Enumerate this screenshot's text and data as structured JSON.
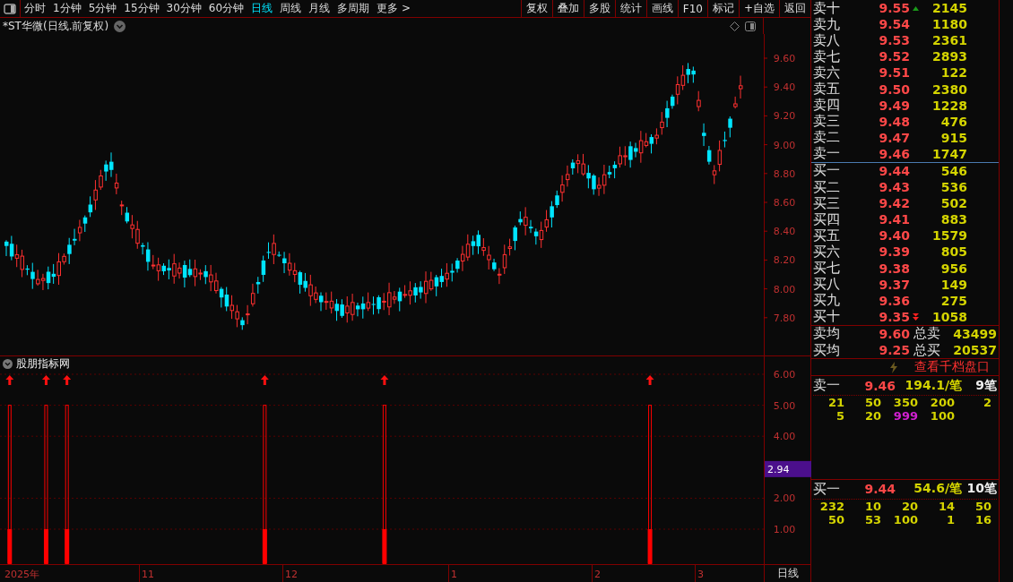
{
  "toolbar": {
    "periods": [
      {
        "label": "分时",
        "selected": false
      },
      {
        "label": "1分钟",
        "selected": false
      },
      {
        "label": "5分钟",
        "selected": false
      },
      {
        "label": "15分钟",
        "selected": false
      },
      {
        "label": "30分钟",
        "selected": false
      },
      {
        "label": "60分钟",
        "selected": false
      },
      {
        "label": "日线",
        "selected": true
      },
      {
        "label": "周线",
        "selected": false
      },
      {
        "label": "月线",
        "selected": false
      },
      {
        "label": "多周期",
        "selected": false
      },
      {
        "label": "更多 >",
        "selected": false
      }
    ],
    "actions": [
      "复权",
      "叠加",
      "多股",
      "统计",
      "画线",
      "F10",
      "标记",
      "+自选",
      "返回"
    ]
  },
  "main_chart": {
    "title": "*ST华微(日线.前复权)",
    "price_ticks": [
      "9.60",
      "9.40",
      "9.20",
      "9.00",
      "8.80",
      "8.60",
      "8.40",
      "8.20",
      "8.00",
      "7.80"
    ]
  },
  "indicator": {
    "title": "股朋指标网",
    "current_value": "2.94",
    "ticks": [
      "6.00",
      "5.00",
      "4.00",
      "2.00",
      "1.00"
    ]
  },
  "date_axis": {
    "labels": [
      "2025年",
      "11",
      "12",
      "1",
      "2",
      "3"
    ],
    "period": "日线"
  },
  "order_book": {
    "asks": [
      {
        "label": "卖十",
        "price": "9.55",
        "volume": "2145",
        "kind": "top"
      },
      {
        "label": "卖九",
        "price": "9.54",
        "volume": "1180",
        "kind": "plain"
      },
      {
        "label": "卖八",
        "price": "9.53",
        "volume": "2361",
        "kind": "plain"
      },
      {
        "label": "卖七",
        "price": "9.52",
        "volume": "2893",
        "kind": "plain"
      },
      {
        "label": "卖六",
        "price": "9.51",
        "volume": "122",
        "kind": "plain"
      },
      {
        "label": "卖五",
        "price": "9.50",
        "volume": "2380",
        "kind": "plain"
      },
      {
        "label": "卖四",
        "price": "9.49",
        "volume": "1228",
        "kind": "plain"
      },
      {
        "label": "卖三",
        "price": "9.48",
        "volume": "476",
        "kind": "plain"
      },
      {
        "label": "卖二",
        "price": "9.47",
        "volume": "915",
        "kind": "plain"
      },
      {
        "label": "卖一",
        "price": "9.46",
        "volume": "1747",
        "kind": "plain"
      }
    ],
    "bids": [
      {
        "label": "买一",
        "price": "9.44",
        "volume": "546",
        "kind": "plain"
      },
      {
        "label": "买二",
        "price": "9.43",
        "volume": "536",
        "kind": "plain"
      },
      {
        "label": "买三",
        "price": "9.42",
        "volume": "502",
        "kind": "plain"
      },
      {
        "label": "买四",
        "price": "9.41",
        "volume": "883",
        "kind": "plain"
      },
      {
        "label": "买五",
        "price": "9.40",
        "volume": "1579",
        "kind": "plain"
      },
      {
        "label": "买六",
        "price": "9.39",
        "volume": "805",
        "kind": "plain"
      },
      {
        "label": "买七",
        "price": "9.38",
        "volume": "956",
        "kind": "plain"
      },
      {
        "label": "买八",
        "price": "9.37",
        "volume": "149",
        "kind": "plain"
      },
      {
        "label": "买九",
        "price": "9.36",
        "volume": "275",
        "kind": "plain"
      },
      {
        "label": "买十",
        "price": "9.35",
        "volume": "1058",
        "kind": "bottom"
      }
    ],
    "summary": [
      {
        "label": "卖均",
        "price": "9.60",
        "total_label": "总卖",
        "total": "43499"
      },
      {
        "label": "买均",
        "price": "9.25",
        "total_label": "总买",
        "total": "20537"
      }
    ],
    "depth_link": "查看千档盘口",
    "queues": [
      {
        "label": "卖一",
        "price": "9.46",
        "avg": "194.1/笔",
        "count": "9笔",
        "rows": [
          [
            {
              "value": "21",
              "large": false
            },
            {
              "value": "50",
              "large": false
            },
            {
              "value": "350",
              "large": false
            },
            {
              "value": "200",
              "large": false
            },
            {
              "value": "2",
              "large": false
            }
          ],
          [
            {
              "value": "5",
              "large": false
            },
            {
              "value": "20",
              "large": false
            },
            {
              "value": "999",
              "large": true
            },
            {
              "value": "100",
              "large": false
            }
          ]
        ]
      },
      {
        "label": "买一",
        "price": "9.44",
        "avg": "54.6/笔",
        "count": "10笔",
        "rows": [
          [
            {
              "value": "232",
              "large": false
            },
            {
              "value": "10",
              "large": false
            },
            {
              "value": "20",
              "large": false
            },
            {
              "value": "14",
              "large": false
            },
            {
              "value": "50",
              "large": false
            }
          ],
          [
            {
              "value": "50",
              "large": false
            },
            {
              "value": "53",
              "large": false
            },
            {
              "value": "100",
              "large": false
            },
            {
              "value": "1",
              "large": false
            },
            {
              "value": "16",
              "large": false
            }
          ]
        ]
      }
    ]
  }
}
